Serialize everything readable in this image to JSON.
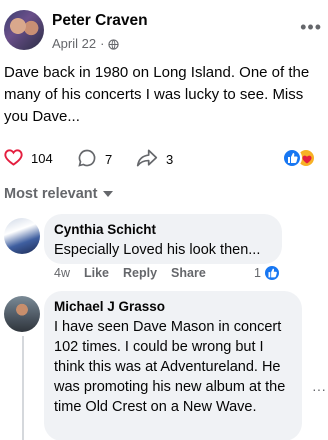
{
  "post": {
    "author": "Peter Craven",
    "date": "April 22",
    "separator": "·",
    "privacy_icon": "globe-icon",
    "body": "Dave back in 1980 on Long Island. One of the many of his concerts I was lucky to see. Miss you Dave...",
    "more_icon": "more-horizontal-icon"
  },
  "stats": {
    "reactions_count": "104",
    "comments_count": "7",
    "shares_count": "3",
    "reaction_types": [
      "like",
      "care"
    ]
  },
  "comments_header": {
    "sort_label": "Most relevant"
  },
  "comments": [
    {
      "name": "Cynthia Schicht",
      "text": "Especially Loved his look then...",
      "age": "4w",
      "like_label": "Like",
      "reply_label": "Reply",
      "share_label": "Share",
      "likes": "1"
    },
    {
      "name": "Michael J Grasso",
      "text": "I have seen Dave Mason in concert 102 times. I could be wrong but I think this was at Adventureland. He was promoting his new album at the time Old Crest on a New Wave."
    }
  ],
  "colors": {
    "accent": "#1877f2",
    "heart": "#e41e3f",
    "secondary_text": "#65676b",
    "bubble": "#f0f2f5"
  }
}
